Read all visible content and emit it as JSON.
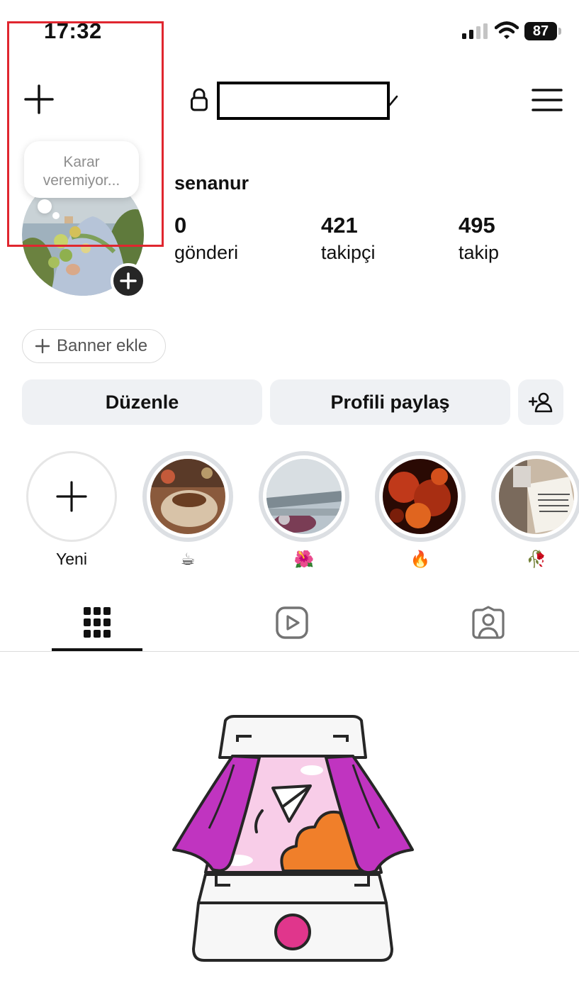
{
  "status_bar": {
    "time": "17:32",
    "battery": "87"
  },
  "header": {
    "create_icon": "plus-icon",
    "lock_icon": "lock-icon",
    "menu_icon": "hamburger-icon"
  },
  "note": {
    "line1": "Karar",
    "line2": "veremiyor..."
  },
  "profile": {
    "name": "senanur",
    "stats": [
      {
        "value": "0",
        "label": "gönderi"
      },
      {
        "value": "421",
        "label": "takipçi"
      },
      {
        "value": "495",
        "label": "takip"
      }
    ]
  },
  "banner": {
    "label": "Banner ekle"
  },
  "actions": {
    "edit": "Düzenle",
    "share": "Profili paylaş",
    "discover_icon": "add-person-icon"
  },
  "highlights": [
    {
      "label": "Yeni"
    },
    {
      "label": "☕"
    },
    {
      "label": "🌺"
    },
    {
      "label": "🔥"
    },
    {
      "label": "🥀"
    }
  ],
  "tabs": [
    {
      "icon": "grid-icon",
      "active": true
    },
    {
      "icon": "reels-icon",
      "active": false
    },
    {
      "icon": "tagged-icon",
      "active": false
    }
  ],
  "colors": {
    "accent_magenta": "#c034c0",
    "orange": "#f07f2a",
    "annotation_red": "#e0262f"
  }
}
